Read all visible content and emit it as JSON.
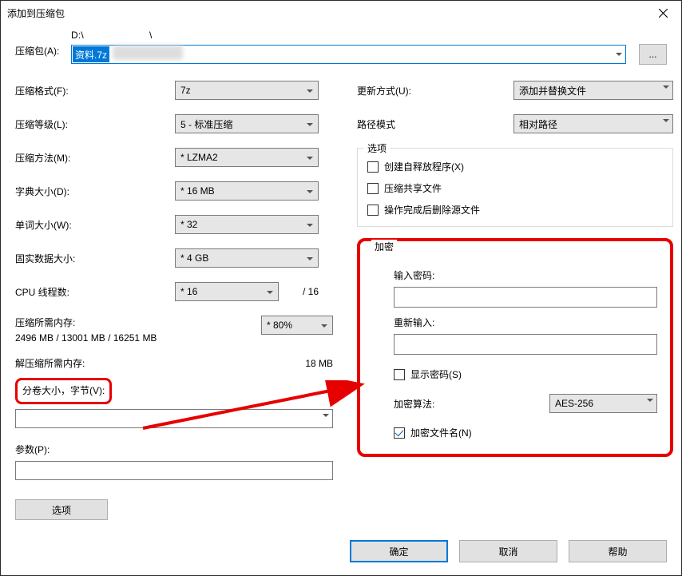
{
  "title": "添加到压缩包",
  "archive": {
    "label": "压缩包(A):",
    "path_prefix": "D:\\",
    "path_suffix": "\\",
    "filename": "资料.7z",
    "browse": "..."
  },
  "left": {
    "format_label": "压缩格式(F):",
    "format_value": "7z",
    "level_label": "压缩等级(L):",
    "level_value": "5 - 标准压缩",
    "method_label": "压缩方法(M):",
    "method_value": "* LZMA2",
    "dict_label": "字典大小(D):",
    "dict_value": "* 16 MB",
    "word_label": "单词大小(W):",
    "word_value": "* 32",
    "solid_label": "固实数据大小:",
    "solid_value": "* 4 GB",
    "cpu_label": "CPU 线程数:",
    "cpu_value": "* 16",
    "cpu_total": "/ 16",
    "mem_enc_label": "压缩所需内存:",
    "mem_enc_percent": "* 80%",
    "mem_enc_detail": "2496 MB / 13001 MB / 16251 MB",
    "mem_dec_label": "解压缩所需内存:",
    "mem_dec_value": "18 MB",
    "volume_label": "分卷大小，字节(V):",
    "param_label": "参数(P):",
    "options_button": "选项"
  },
  "right": {
    "update_label": "更新方式(U):",
    "update_value": "添加并替换文件",
    "path_label": "路径模式",
    "path_value": "相对路径",
    "options_legend": "选项",
    "sfx_label": "创建自释放程序(X)",
    "shared_label": "压缩共享文件",
    "delete_label": "操作完成后删除源文件",
    "enc_legend": "加密",
    "pwd_label": "输入密码:",
    "pwd2_label": "重新输入:",
    "show_pwd_label": "显示密码(S)",
    "alg_label": "加密算法:",
    "alg_value": "AES-256",
    "enc_names_label": "加密文件名(N)"
  },
  "buttons": {
    "ok": "确定",
    "cancel": "取消",
    "help": "帮助"
  }
}
